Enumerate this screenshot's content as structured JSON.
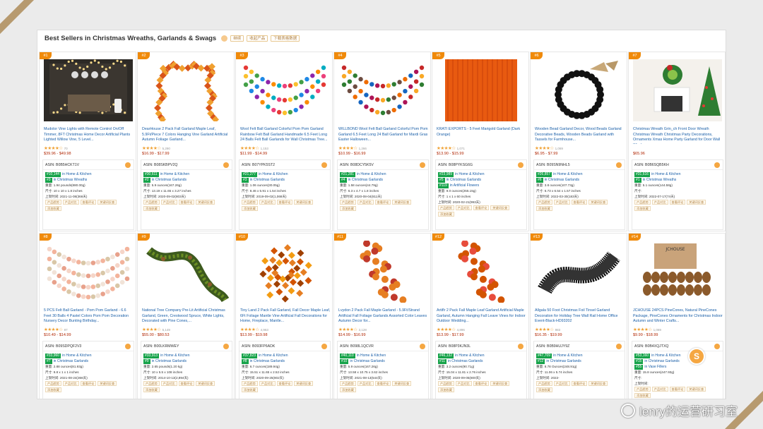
{
  "page": {
    "heading": "Best Sellers in Christmas Wreaths, Garlands & Swags",
    "tags": [
      "继续",
      "收起产品",
      "下载表格数据"
    ],
    "accent_color": "#f08a0a",
    "rank_badge_color": "#16a34a",
    "link_color": "#1a5fa8"
  },
  "watermark": {
    "text": "lenry的运营研习室"
  },
  "fab": {
    "label": "S"
  },
  "actions": [
    "产品趋势",
    "产品对比",
    "查看评论",
    "关键词反查",
    "添加收藏"
  ],
  "products": [
    {
      "rank": "#1",
      "title": "Mudolor Vine Lights with Remote Control On/Off Timmer, 8FT Christmas Home Decor Artificial Plants Lighted Willow Vine, 5 Level...",
      "stars": "★★★★☆",
      "reviews": "70",
      "price": "$39.96 - $49.98",
      "asin": "ASIN: B0B5HCKT1V",
      "r1": "#10,144",
      "c1": "in Home & Kitchen",
      "r2": "#3",
      "c2": "in Christmas Wreaths",
      "s1": "重量: 1.94 pounds(880.00g)",
      "s2": "尺寸: 10 x 10 x 1.8 inches",
      "s3": "上架时间: 2021-11-08(366天)"
    },
    {
      "rank": "#2",
      "title": "DearHouse 2 Pack Fall Garland Maple Leaf, 5.9Ft/Piece 7 Colors Hanging Vine Garland Artificial Autumn Foliage Garland...",
      "stars": "★★★★☆",
      "reviews": "5,290",
      "price": "$16.99 - $17.99",
      "asin": "ASIN: B08SKBPV2Q",
      "r1": "#30,611",
      "c1": "in Home & Kitchen",
      "r2": "#2",
      "c2": "in Christmas Garlands",
      "s1": "重量: 5.9 ounces(167.26g)",
      "s2": "尺寸: 13.19 x 11.65 x 3.27 inches",
      "s3": "上架时间: 2020-09-02(803天)"
    },
    {
      "rank": "#3",
      "title": "Wool Felt Ball Garland Colorful Pom Pom Garland Rainbow Felt Ball Garland Handmade 6.5 Feet Long 24 Balls Felt Ball Garlands for Wall Christmas Tree...",
      "stars": "★★★★☆",
      "reviews": "1,153",
      "price": "$11.99 - $14.99",
      "asin": "ASIN: B07YPK5ST2",
      "r1": "#21,277",
      "c1": "in Home & Kitchen",
      "r2": "#3",
      "c2": "in Christmas Garlands",
      "s1": "重量: 1.06 ounces(30.05g)",
      "s2": "尺寸: 8.46 x 5.91 x 1.54 inches",
      "s3": "上架时间: 2019-09-02(1,068天)"
    },
    {
      "rank": "#4",
      "title": "WILLBOND Wool Felt Ball Garland Colorful Pom Pom Garland 6.5 Feet Long 24 Ball Garland for Mardi Gras Easter Halloween...",
      "stars": "★★★★☆",
      "reviews": "1,266",
      "price": "$10.99 - $16.99",
      "asin": "ASIN: B08DCY5K5V",
      "r1": "#21,281",
      "c1": "in Home & Kitchen",
      "r2": "#4",
      "c2": "in Christmas Garlands",
      "s1": "重量: 1.58 ounces(44.79g)",
      "s2": "尺寸: 6.3 x 4.7 x 1.8 inches",
      "s3": "上架时间: 2020-08-04(811天)"
    },
    {
      "rank": "#5",
      "title": "KRATI EXPORTS - 5 Feet Marigold Garland (Dark Orange)",
      "stars": "★★★★☆",
      "reviews": "1,071",
      "price": "$13.90 - $15.99",
      "asin": "ASIN: B08PYKSG6G",
      "r1": "#23,989",
      "c1": "in Home & Kitchen",
      "r2": "#5",
      "c2": "in Christmas Garlands",
      "r3": "#119",
      "c3": "in Artificial Flowers",
      "s1": "重量: 9.0 ounces(255.15g)",
      "s2": "尺寸: 1 x 1 x 60 inches",
      "s3": "上架时间: 2020-02-21(993天)"
    },
    {
      "rank": "#6",
      "title": "Wooden Bead Garland Decor, Wood Beads Garland Decorative Beads, Wooden Beads Garland with Tassels for Farmhouse...",
      "stars": "★★★★☆",
      "reviews": "1,069",
      "price": "$6.95 - $7.99",
      "asin": "ASIN: B09SN9NHL5",
      "r1": "#26,857",
      "c1": "in Home & Kitchen",
      "r2": "#6",
      "c2": "in Christmas Garlands",
      "s1": "重量: 3.8 ounces(107.73g)",
      "s2": "尺寸: 6.73 x 6.54 x 1.57 inches",
      "s3": "上架时间: 2022-03-30(183天)"
    },
    {
      "rank": "#7",
      "title": "Christmas Wreath Grin_ch Front Door Wreath Christmas Wreath Christmas Party Decorations, Ornaments Xmas Home Party Garland for Door Wall Window",
      "stars": "",
      "reviews": "",
      "price": "$65.96",
      "asin": "ASIN: B0B6SQB5KH",
      "r1": "#31,616",
      "c1": "in Home & Kitchen",
      "r2": "#1",
      "c2": "in Christmas Wreaths",
      "s1": "重量: 5.1 ounces(144.58g)",
      "s2": "尺寸:",
      "s3": "上架时间: 2022-07-17(74天)"
    },
    {
      "rank": "#8",
      "title": "5 PCS Felt Ball Garland - Pom Pom Garland - 6.6 Feet 30 Balls 4 Pastel Colors Pom Pom Decoration Nursery Decor Bunting Birthday...",
      "stars": "★★★★☆",
      "reviews": "87",
      "price": "$10.49 - $14.99",
      "asin": "ASIN: B09SDPQF2V3",
      "r1": "#33,960",
      "c1": "in Home & Kitchen",
      "r2": "#7",
      "c2": "in Christmas Garlands",
      "s1": "重量: 2.88 ounces(81.93g)",
      "s2": "尺寸: 9.8 x 1 x 1 inches",
      "s3": "上架时间: 2021-08-24(366天)"
    },
    {
      "rank": "#9",
      "title": "National Tree Company Pre-Lit Artificial Christmas Garland, Green, Crestwood Spruce, White Lights, Decorated with Pine Cones,...",
      "stars": "★★★★☆",
      "reviews": "5,149",
      "price": "$55.00 - $80.53",
      "asin": "ASIN: B00LKRMWEY",
      "r1": "#33,913",
      "c1": "in Home & Kitchen",
      "r2": "#9",
      "c2": "in Christmas Garlands",
      "s1": "重量: 2.65 pounds(1.20 kg)",
      "s2": "尺寸: 10 x 5.5 x 108 inches",
      "s3": "上架时间: 2014-10-13(2,894天)"
    },
    {
      "rank": "#10",
      "title": "Tiny Land 2 Pack Fall Garland, Fall Decor Maple Leaf, 6Ft Foliage Mantle Vine Artificial Fall Decorations for Home, Fireplace, Mantle...",
      "stars": "★★★★☆",
      "reviews": "4,963",
      "price": "$13.99 - $19.98",
      "asin": "ASIN: B093FP6ADK",
      "r1": "#37,823",
      "c1": "in Home & Kitchen",
      "r2": "#8",
      "c2": "in Christmas Garlands",
      "s1": "重量: 6.7 ounces(189.94g)",
      "s2": "尺寸: 15.51 x 11.65 x 2.52 inches",
      "s3": "上架时间: 2020-09-25(802天)"
    },
    {
      "rank": "#11",
      "title": "Lvydon 2 Pack Fall Maple Garland - 5.9Ft/Strand Artificial Fall Foliage Garlands Assorted Color Leaves Autumn Decor for...",
      "stars": "★★★★☆",
      "reviews": "3,128",
      "price": "$14.99 - $16.99",
      "asin": "ASIN: B098L1QCVR",
      "r1": "#40,110",
      "c1": "in Home & Kitchen",
      "r2": "#10",
      "c2": "in Christmas Garlands",
      "s1": "重量: 5.9 ounces(167.26g)",
      "s2": "尺寸: 13.58 x 10.75 x 3.62 inches",
      "s3": "上架时间: 2021-08-13(544天)"
    },
    {
      "rank": "#12",
      "title": "Artiflr 2 Pack Fall Maple Leaf Garland Artificial Maple Garland, Autumn Hanging Fall Leave Vines for Indoor Outdoor Wedding...",
      "stars": "★★★★☆",
      "reviews": "4,896",
      "price": "$13.99 - $17.99",
      "asin": "ASIN: B08P3KJN3L",
      "r1": "#46,132",
      "c1": "in Home & Kitchen",
      "r2": "#11",
      "c2": "in Christmas Garlands",
      "s1": "重量: 3.2 ounces(90.71g)",
      "s2": "尺寸: 15.04 x 11.81 x 2.76 inches",
      "s3": "上架时间: 2020-09-05(800天)"
    },
    {
      "rank": "#13",
      "title": "Allgala 50 Foot Christmas Foil Tinsel Garland Decoration for Holiday Tree Wall Rail Home Office Event-Black-HD93202",
      "stars": "★★★★☆",
      "reviews": "983",
      "price": "$16.35 - $19.99",
      "asin": "ASIN: B0B9HUJY9Z",
      "r1": "#47,709",
      "c1": "in Home & Kitchen",
      "r2": "#12",
      "c2": "in Christmas Garlands",
      "s1": "重量: 8.78 Ounces(248.91g)",
      "s2": "尺寸: 11.06 x 5.74 inches",
      "s3": "上架时间: 2022-"
    },
    {
      "rank": "#14",
      "title": "JCHOUSE 24PCS PineCones, Natural PineCones Package, PineCones Ornaments for Christmas Indoor Autumn and Winter Crafts...",
      "stars": "★★★★☆",
      "reviews": "1,069",
      "price": "$9.99 - $18.99",
      "asin": "ASIN: B0B4XQJTXQ",
      "r1": "#53,160",
      "c1": "in Home & Kitchen",
      "r2": "#15",
      "c2": "in Christmas Garlands",
      "r3": "#55",
      "c3": "in Vase Fillers",
      "s1": "重量: 15.8 ounces(447.93g)",
      "s2": "尺寸:",
      "s3": "上架时间:"
    }
  ]
}
